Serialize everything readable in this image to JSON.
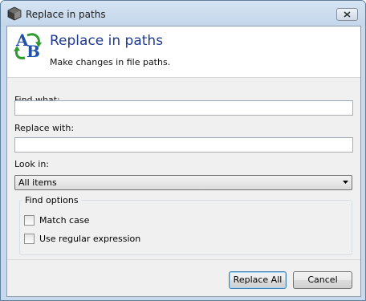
{
  "window": {
    "title": "Replace in paths",
    "icon": "app-cube-icon"
  },
  "titlebar": {
    "close_icon": "close-icon"
  },
  "header": {
    "icon": "ab-replace-icon",
    "title": "Replace in paths",
    "subtitle": "Make changes in file paths."
  },
  "form": {
    "find_label": "Find what:",
    "find_value": "",
    "replace_label": "Replace with:",
    "replace_value": "",
    "look_in_label": "Look in:",
    "look_in_value": "All items"
  },
  "options": {
    "legend": "Find options",
    "match_case_label": "Match case",
    "match_case_checked": false,
    "regex_label": "Use regular expression",
    "regex_checked": false
  },
  "buttons": {
    "replace_all": "Replace All",
    "cancel": "Cancel"
  },
  "colors": {
    "header_title": "#1e3a8e",
    "frame": "#c7d9ec",
    "default_button_border": "#3c7fb1"
  }
}
